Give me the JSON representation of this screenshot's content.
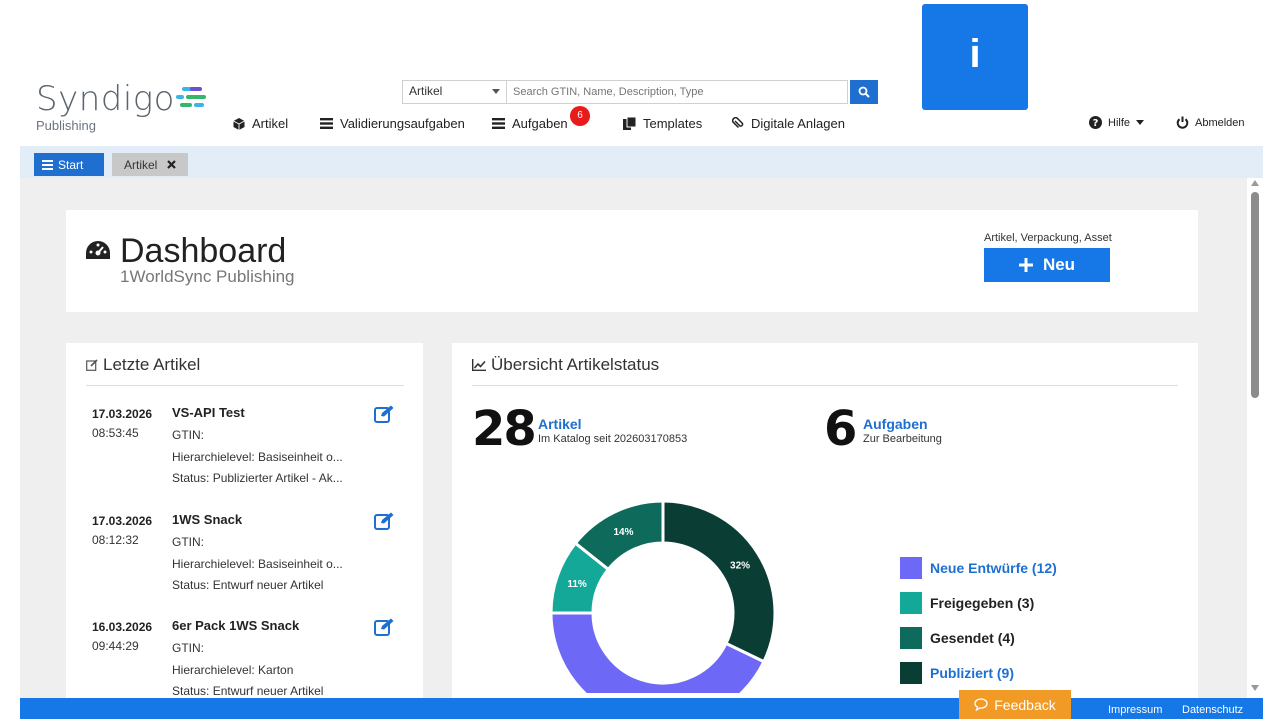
{
  "header": {
    "logo_text": "Syndigo",
    "logo_sub": "Publishing",
    "search": {
      "type_value": "Artikel",
      "placeholder": "Search GTIN, Name, Description, Type"
    },
    "info_tile": "i",
    "nav": [
      {
        "label": "Artikel",
        "icon": "cube-icon"
      },
      {
        "label": "Validierungsaufgaben",
        "icon": "list-icon"
      },
      {
        "label": "Aufgaben",
        "icon": "list-icon",
        "badge": "6"
      },
      {
        "label": "Templates",
        "icon": "copy-icon"
      },
      {
        "label": "Digitale Anlagen",
        "icon": "paperclip-icon"
      }
    ],
    "help_label": "Hilfe",
    "logout_label": "Abmelden"
  },
  "tabs": {
    "start_label": "Start",
    "artikel_label": "Artikel"
  },
  "dashboard": {
    "title": "Dashboard",
    "subtitle": "1WorldSync Publishing",
    "new_caption": "Artikel, Verpackung, Asset",
    "new_label": "Neu"
  },
  "recent": {
    "heading": "Letzte Artikel",
    "items": [
      {
        "date": "17.03.2026",
        "time": "08:53:45",
        "title": "VS-API Test",
        "gtin": "GTIN:",
        "hierarchy": "Hierarchielevel: Basiseinheit o...",
        "status": "Status: Publizierter Artikel - Ak..."
      },
      {
        "date": "17.03.2026",
        "time": "08:12:32",
        "title": "1WS Snack",
        "gtin": "GTIN:",
        "hierarchy": "Hierarchielevel: Basiseinheit o...",
        "status": "Status: Entwurf neuer Artikel"
      },
      {
        "date": "16.03.2026",
        "time": "09:44:29",
        "title": "6er Pack 1WS Snack",
        "gtin": "GTIN:",
        "hierarchy": "Hierarchielevel: Karton",
        "status": "Status: Entwurf neuer Artikel"
      }
    ]
  },
  "overview": {
    "heading": "Übersicht Artikelstatus",
    "articles_count": "28",
    "articles_label": "Artikel",
    "articles_sub": "Im Katalog seit 202603170853",
    "tasks_count": "6",
    "tasks_label": "Aufgaben",
    "tasks_sub": "Zur Bearbeitung"
  },
  "chart_data": {
    "type": "pie",
    "donut": true,
    "categories": [
      "Neue Entwürfe",
      "Freigegeben",
      "Gesendet",
      "Publiziert"
    ],
    "values": [
      12,
      3,
      4,
      9
    ],
    "slice_labels": [
      "",
      "11%",
      "14%",
      "32%"
    ],
    "legend_text": [
      "Neue Entwürfe (12)",
      "Freigegeben (3)",
      "Gesendet (4)",
      "Publiziert (9)"
    ],
    "colors": [
      "#6d68f5",
      "#14a898",
      "#0e6b5c",
      "#0a3d34"
    ],
    "legend_placement": "right"
  },
  "footer": {
    "feedback_label": "Feedback",
    "impressum": "Impressum",
    "datenschutz": "Datenschutz"
  }
}
